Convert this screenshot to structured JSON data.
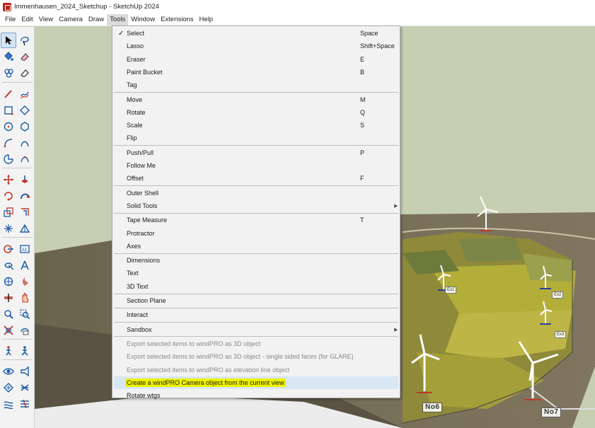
{
  "window": {
    "title": "Immenhausen_2024_Sketchup - SketchUp 2024",
    "app_icon": "sketchup-logo-icon"
  },
  "menubar": {
    "items": [
      "File",
      "Edit",
      "View",
      "Camera",
      "Draw",
      "Tools",
      "Window",
      "Extensions",
      "Help"
    ],
    "active": "Tools"
  },
  "toolbar": {
    "icons": [
      [
        "select-arrow-icon",
        "lasso-icon"
      ],
      [
        "paint-bucket-icon",
        "eraser-icon"
      ],
      [
        "components-icon",
        "eraser-alt-icon"
      ],
      [
        "pencil-line-icon",
        "freehand-icon"
      ],
      [
        "rectangle-icon",
        "rotated-rectangle-icon"
      ],
      [
        "circle-icon",
        "polygon-icon"
      ],
      [
        "arc-icon",
        "two-point-arc-icon"
      ],
      [
        "pie-icon",
        "three-point-arc-icon"
      ],
      [
        "move-icon",
        "push-pull-icon"
      ],
      [
        "rotate-icon",
        "follow-me-icon"
      ],
      [
        "scale-icon",
        "offset-icon"
      ],
      [
        "axes-icon",
        "protractor-icon"
      ],
      [
        "tape-measure-icon",
        "dimensions-icon"
      ],
      [
        "text-icon",
        "3d-text-icon"
      ],
      [
        "orbit-icon",
        "section-plane-icon"
      ],
      [
        "section-cut-icon",
        "pan-icon"
      ],
      [
        "zoom-icon",
        "zoom-window-icon"
      ],
      [
        "zoom-extents-icon",
        "previous-view-icon"
      ],
      [
        "walk-icon",
        "position-camera-icon"
      ],
      [
        "look-around-icon",
        "tag-icon"
      ],
      [
        "sandbox-icon",
        "stamp-icon"
      ],
      [
        "drape-icon",
        "flip-edge-icon"
      ]
    ]
  },
  "tools_menu": {
    "groups": [
      [
        {
          "label": "Select",
          "shortcut": "Space",
          "checked": true
        },
        {
          "label": "Lasso",
          "shortcut": "Shift+Space"
        },
        {
          "label": "Eraser",
          "shortcut": "E"
        },
        {
          "label": "Paint Bucket",
          "shortcut": "B"
        },
        {
          "label": "Tag",
          "shortcut": ""
        }
      ],
      [
        {
          "label": "Move",
          "shortcut": "M"
        },
        {
          "label": "Rotate",
          "shortcut": "Q"
        },
        {
          "label": "Scale",
          "shortcut": "S"
        },
        {
          "label": "Flip",
          "shortcut": ""
        }
      ],
      [
        {
          "label": "Push/Pull",
          "shortcut": "P"
        },
        {
          "label": "Follow Me",
          "shortcut": ""
        },
        {
          "label": "Offset",
          "shortcut": "F"
        }
      ],
      [
        {
          "label": "Outer Shell",
          "shortcut": ""
        },
        {
          "label": "Solid Tools",
          "shortcut": "",
          "submenu": true
        }
      ],
      [
        {
          "label": "Tape Measure",
          "shortcut": "T"
        },
        {
          "label": "Protractor",
          "shortcut": ""
        },
        {
          "label": "Axes",
          "shortcut": ""
        }
      ],
      [
        {
          "label": "Dimensions",
          "shortcut": ""
        },
        {
          "label": "Text",
          "shortcut": ""
        },
        {
          "label": "3D Text",
          "shortcut": ""
        }
      ],
      [
        {
          "label": "Section Plane",
          "shortcut": ""
        }
      ],
      [
        {
          "label": "Interact",
          "shortcut": ""
        }
      ],
      [
        {
          "label": "Sandbox",
          "shortcut": "",
          "submenu": true
        }
      ],
      [
        {
          "label": "Export selected items to windPRO as 3D object",
          "shortcut": "",
          "disabled": true
        },
        {
          "label": "Export selected items to windPRO as 3D object - single sided faces (for GLARE)",
          "shortcut": "",
          "disabled": true
        },
        {
          "label": "Export selected items to windPRO as elevation line object",
          "shortcut": "",
          "disabled": true
        },
        {
          "label": "Create a windPRO Camera object from the current view",
          "shortcut": "",
          "hover": true,
          "highlighted": true
        },
        {
          "label": "Rotate wtgs",
          "shortcut": ""
        }
      ]
    ]
  },
  "viewport": {
    "turbine_labels": [
      "No6",
      "No7"
    ],
    "existing_labels": [
      "Ex1",
      "Ex2",
      "Ex2",
      "Ex3"
    ],
    "colors": {
      "sky": "#c7cfb2",
      "field_highlight": "#bdb52a",
      "highlight_marker": "#eef200",
      "menu_hover": "#d9e6f3"
    }
  }
}
